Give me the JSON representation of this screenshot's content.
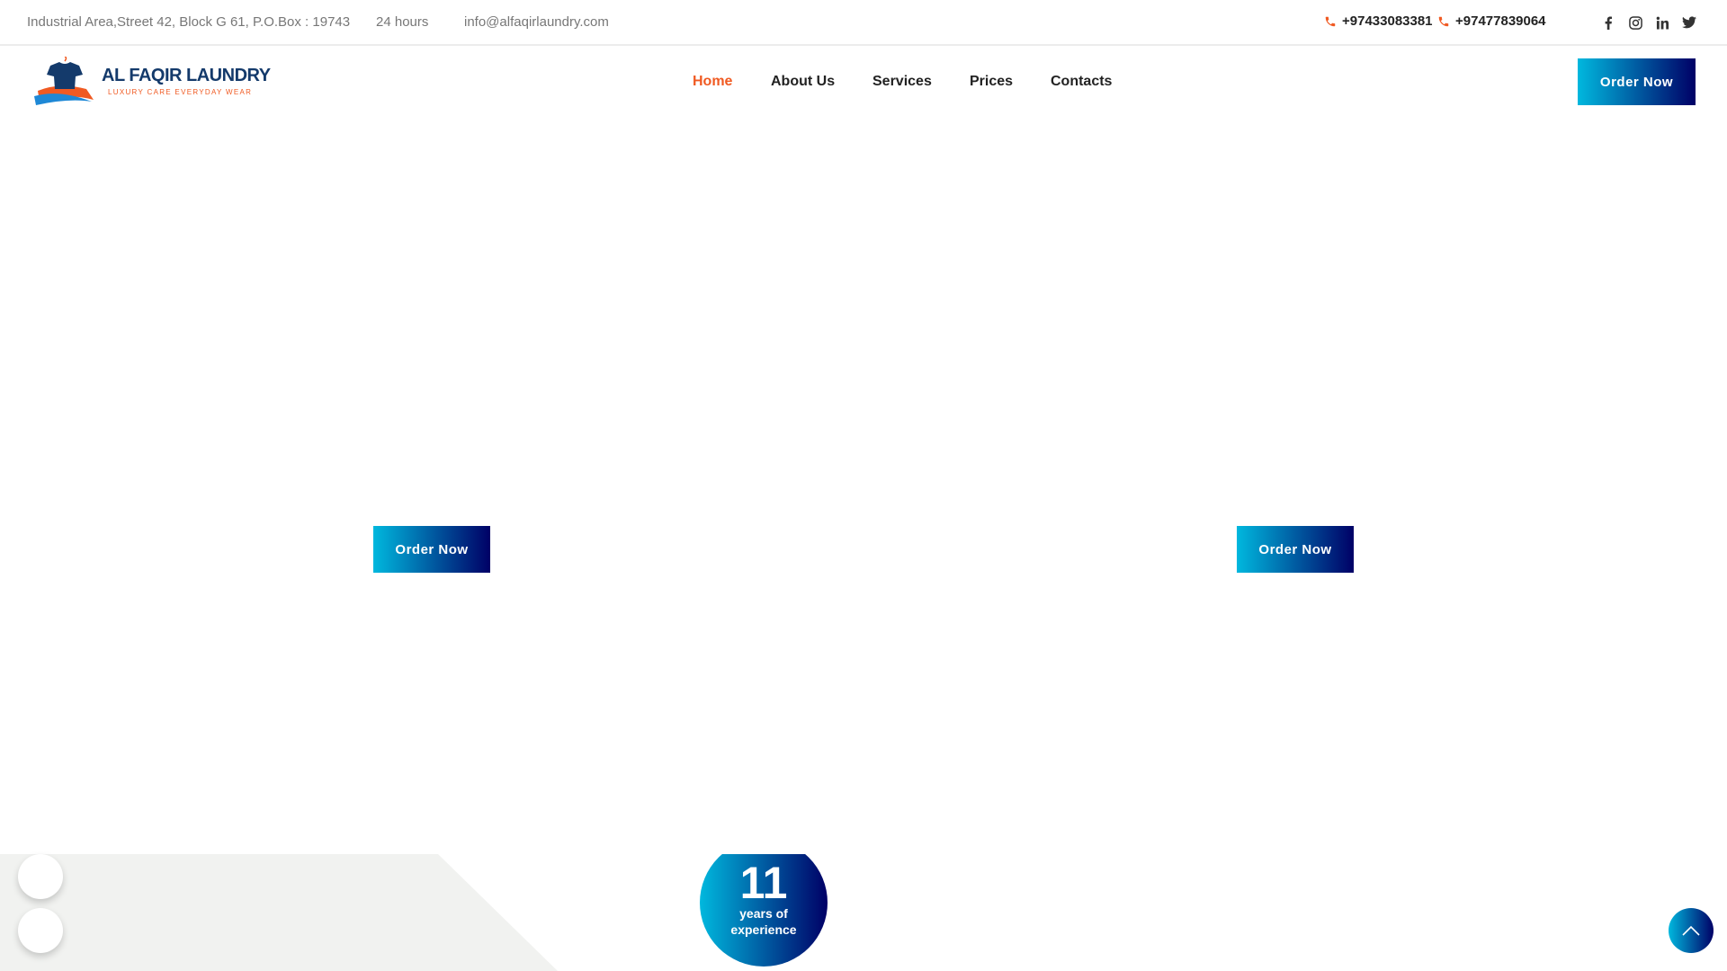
{
  "topbar": {
    "address": "Industrial Area,Street 42, Block G 61, P.O.Box : 19743",
    "hours": "24 hours",
    "email": "info@alfaqirlaundry.com",
    "phones": [
      "+97433083381",
      "+97477839064"
    ]
  },
  "logo": {
    "title": "AL FAQIR LAUNDRY",
    "tagline": "LUXURY CARE  EVERYDAY WEAR"
  },
  "nav": {
    "items": [
      "Home",
      "About Us",
      "Services",
      "Prices",
      "Contacts"
    ],
    "active": "Home",
    "order_label": "Order Now"
  },
  "hero": {
    "buttons": [
      "Order Now",
      "Order Now"
    ]
  },
  "experience": {
    "number": "11",
    "label_line1": "years of",
    "label_line2": "experience"
  },
  "colors": {
    "accent": "#f05a22",
    "gradient_start": "#00b8de",
    "gradient_end": "#000066"
  }
}
